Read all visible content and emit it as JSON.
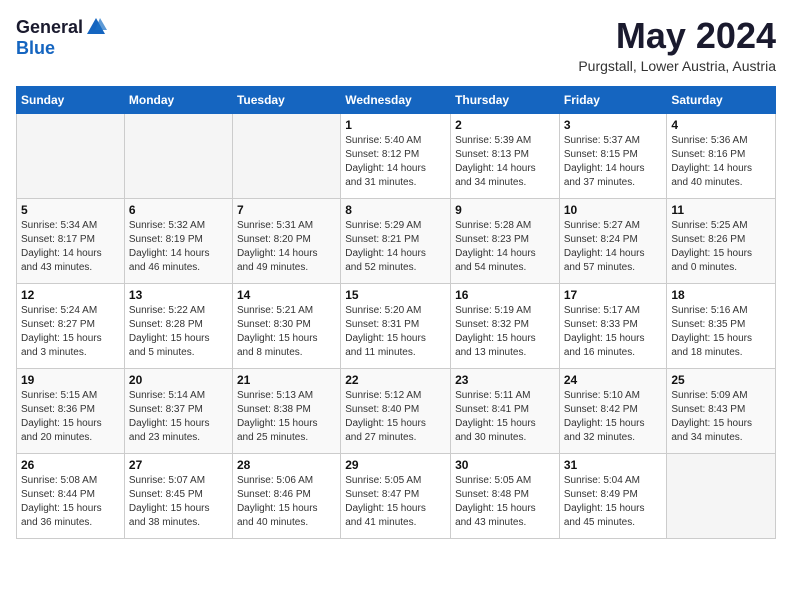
{
  "header": {
    "logo_general": "General",
    "logo_blue": "Blue",
    "month_title": "May 2024",
    "subtitle": "Purgstall, Lower Austria, Austria"
  },
  "days_of_week": [
    "Sunday",
    "Monday",
    "Tuesday",
    "Wednesday",
    "Thursday",
    "Friday",
    "Saturday"
  ],
  "weeks": [
    {
      "days": [
        {
          "number": "",
          "info": "",
          "empty": true
        },
        {
          "number": "",
          "info": "",
          "empty": true
        },
        {
          "number": "",
          "info": "",
          "empty": true
        },
        {
          "number": "1",
          "info": "Sunrise: 5:40 AM\nSunset: 8:12 PM\nDaylight: 14 hours\nand 31 minutes."
        },
        {
          "number": "2",
          "info": "Sunrise: 5:39 AM\nSunset: 8:13 PM\nDaylight: 14 hours\nand 34 minutes."
        },
        {
          "number": "3",
          "info": "Sunrise: 5:37 AM\nSunset: 8:15 PM\nDaylight: 14 hours\nand 37 minutes."
        },
        {
          "number": "4",
          "info": "Sunrise: 5:36 AM\nSunset: 8:16 PM\nDaylight: 14 hours\nand 40 minutes."
        }
      ]
    },
    {
      "days": [
        {
          "number": "5",
          "info": "Sunrise: 5:34 AM\nSunset: 8:17 PM\nDaylight: 14 hours\nand 43 minutes."
        },
        {
          "number": "6",
          "info": "Sunrise: 5:32 AM\nSunset: 8:19 PM\nDaylight: 14 hours\nand 46 minutes."
        },
        {
          "number": "7",
          "info": "Sunrise: 5:31 AM\nSunset: 8:20 PM\nDaylight: 14 hours\nand 49 minutes."
        },
        {
          "number": "8",
          "info": "Sunrise: 5:29 AM\nSunset: 8:21 PM\nDaylight: 14 hours\nand 52 minutes."
        },
        {
          "number": "9",
          "info": "Sunrise: 5:28 AM\nSunset: 8:23 PM\nDaylight: 14 hours\nand 54 minutes."
        },
        {
          "number": "10",
          "info": "Sunrise: 5:27 AM\nSunset: 8:24 PM\nDaylight: 14 hours\nand 57 minutes."
        },
        {
          "number": "11",
          "info": "Sunrise: 5:25 AM\nSunset: 8:26 PM\nDaylight: 15 hours\nand 0 minutes."
        }
      ]
    },
    {
      "days": [
        {
          "number": "12",
          "info": "Sunrise: 5:24 AM\nSunset: 8:27 PM\nDaylight: 15 hours\nand 3 minutes."
        },
        {
          "number": "13",
          "info": "Sunrise: 5:22 AM\nSunset: 8:28 PM\nDaylight: 15 hours\nand 5 minutes."
        },
        {
          "number": "14",
          "info": "Sunrise: 5:21 AM\nSunset: 8:30 PM\nDaylight: 15 hours\nand 8 minutes."
        },
        {
          "number": "15",
          "info": "Sunrise: 5:20 AM\nSunset: 8:31 PM\nDaylight: 15 hours\nand 11 minutes."
        },
        {
          "number": "16",
          "info": "Sunrise: 5:19 AM\nSunset: 8:32 PM\nDaylight: 15 hours\nand 13 minutes."
        },
        {
          "number": "17",
          "info": "Sunrise: 5:17 AM\nSunset: 8:33 PM\nDaylight: 15 hours\nand 16 minutes."
        },
        {
          "number": "18",
          "info": "Sunrise: 5:16 AM\nSunset: 8:35 PM\nDaylight: 15 hours\nand 18 minutes."
        }
      ]
    },
    {
      "days": [
        {
          "number": "19",
          "info": "Sunrise: 5:15 AM\nSunset: 8:36 PM\nDaylight: 15 hours\nand 20 minutes."
        },
        {
          "number": "20",
          "info": "Sunrise: 5:14 AM\nSunset: 8:37 PM\nDaylight: 15 hours\nand 23 minutes."
        },
        {
          "number": "21",
          "info": "Sunrise: 5:13 AM\nSunset: 8:38 PM\nDaylight: 15 hours\nand 25 minutes."
        },
        {
          "number": "22",
          "info": "Sunrise: 5:12 AM\nSunset: 8:40 PM\nDaylight: 15 hours\nand 27 minutes."
        },
        {
          "number": "23",
          "info": "Sunrise: 5:11 AM\nSunset: 8:41 PM\nDaylight: 15 hours\nand 30 minutes."
        },
        {
          "number": "24",
          "info": "Sunrise: 5:10 AM\nSunset: 8:42 PM\nDaylight: 15 hours\nand 32 minutes."
        },
        {
          "number": "25",
          "info": "Sunrise: 5:09 AM\nSunset: 8:43 PM\nDaylight: 15 hours\nand 34 minutes."
        }
      ]
    },
    {
      "days": [
        {
          "number": "26",
          "info": "Sunrise: 5:08 AM\nSunset: 8:44 PM\nDaylight: 15 hours\nand 36 minutes."
        },
        {
          "number": "27",
          "info": "Sunrise: 5:07 AM\nSunset: 8:45 PM\nDaylight: 15 hours\nand 38 minutes."
        },
        {
          "number": "28",
          "info": "Sunrise: 5:06 AM\nSunset: 8:46 PM\nDaylight: 15 hours\nand 40 minutes."
        },
        {
          "number": "29",
          "info": "Sunrise: 5:05 AM\nSunset: 8:47 PM\nDaylight: 15 hours\nand 41 minutes."
        },
        {
          "number": "30",
          "info": "Sunrise: 5:05 AM\nSunset: 8:48 PM\nDaylight: 15 hours\nand 43 minutes."
        },
        {
          "number": "31",
          "info": "Sunrise: 5:04 AM\nSunset: 8:49 PM\nDaylight: 15 hours\nand 45 minutes."
        },
        {
          "number": "",
          "info": "",
          "empty": true
        }
      ]
    }
  ]
}
